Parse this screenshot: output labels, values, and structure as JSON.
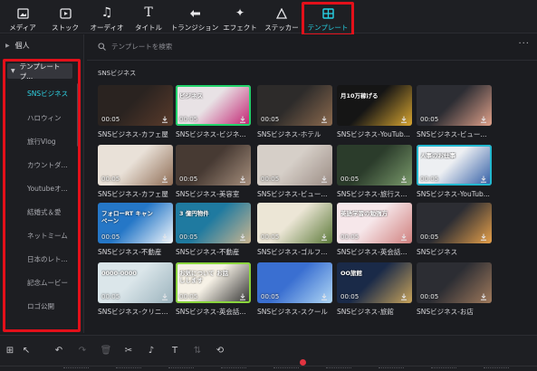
{
  "toolbar": {
    "items": [
      {
        "label": "メディア",
        "icon": "media-icon"
      },
      {
        "label": "ストック",
        "icon": "stock-icon"
      },
      {
        "label": "オーディオ",
        "icon": "music-note-icon"
      },
      {
        "label": "タイトル",
        "icon": "title-t-icon"
      },
      {
        "label": "トランジション",
        "icon": "transition-icon"
      },
      {
        "label": "エフェクト",
        "icon": "effects-icon"
      },
      {
        "label": "ステッカー",
        "icon": "sticker-icon"
      },
      {
        "label": "テンプレート",
        "icon": "template-icon",
        "active": true
      }
    ]
  },
  "sidebar": {
    "top_label": "個人",
    "group_label": "テンプレートプ...",
    "items": [
      {
        "label": "SNSビジネス",
        "active": true
      },
      {
        "label": "ハロウィン"
      },
      {
        "label": "旅行Vlog"
      },
      {
        "label": "カウントダ..."
      },
      {
        "label": "Youtubeオ..."
      },
      {
        "label": "結婚式＆愛"
      },
      {
        "label": "ネットミーム"
      },
      {
        "label": "日本のレト..."
      },
      {
        "label": "記念ムービー"
      },
      {
        "label": "ロゴ公開"
      }
    ]
  },
  "content": {
    "search_placeholder": "テンプレートを検索",
    "section_title": "SNSビジネス",
    "cards": [
      {
        "title": "SNSビジネス-カフェ屋",
        "duration": "00:05",
        "thumb_text": ""
      },
      {
        "title": "SNSビジネス-ビジネ...",
        "duration": "00:05",
        "thumb_text": "ビジネス"
      },
      {
        "title": "SNSビジネス-ホテル",
        "duration": "00:05",
        "thumb_text": ""
      },
      {
        "title": "SNSビジネス-YouTub...",
        "duration": "",
        "thumb_text": "月10万稼げる"
      },
      {
        "title": "SNSビジネス-ビュー...",
        "duration": "00:05",
        "thumb_text": ""
      },
      {
        "title": "SNSビジネス-カフェ屋",
        "duration": "00:05",
        "thumb_text": ""
      },
      {
        "title": "SNSビジネス-美容室",
        "duration": "00:05",
        "thumb_text": ""
      },
      {
        "title": "SNSビジネス-ビュー...",
        "duration": "00:05",
        "thumb_text": ""
      },
      {
        "title": "SNSビジネス-旅行ス...",
        "duration": "00:05",
        "thumb_text": ""
      },
      {
        "title": "SNSビジネス-YouTub...",
        "duration": "00:05",
        "thumb_text": "人事のお仕事"
      },
      {
        "title": "SNSビジネス-不動産",
        "duration": "00:05",
        "thumb_text": "フォローRT キャンペーン"
      },
      {
        "title": "SNSビジネス-不動産",
        "duration": "00:05",
        "thumb_text": "3 億円物件"
      },
      {
        "title": "SNSビジネス-ゴルフ...",
        "duration": "00:05",
        "thumb_text": ""
      },
      {
        "title": "SNSビジネス-英会話...",
        "duration": "00:05",
        "thumb_text": "英語学習の勉強方"
      },
      {
        "title": "SNSビジネス",
        "duration": "00:05",
        "thumb_text": ""
      },
      {
        "title": "SNSビジネス-クリニ...",
        "duration": "00:05",
        "thumb_text": "0000-0000"
      },
      {
        "title": "SNSビジネス-英会話...",
        "duration": "00:05",
        "thumb_text": "お気について お話しします"
      },
      {
        "title": "SNSビジネス-スクール",
        "duration": "00:05",
        "thumb_text": ""
      },
      {
        "title": "SNSビジネス-旅館",
        "duration": "00:05",
        "thumb_text": "OO旅館"
      },
      {
        "title": "SNSビジネス-お店",
        "duration": "00:05",
        "thumb_text": ""
      }
    ]
  },
  "colors": {
    "accent": "#27d3e6",
    "highlight": "#e3101a",
    "playhead": "#e23340"
  }
}
